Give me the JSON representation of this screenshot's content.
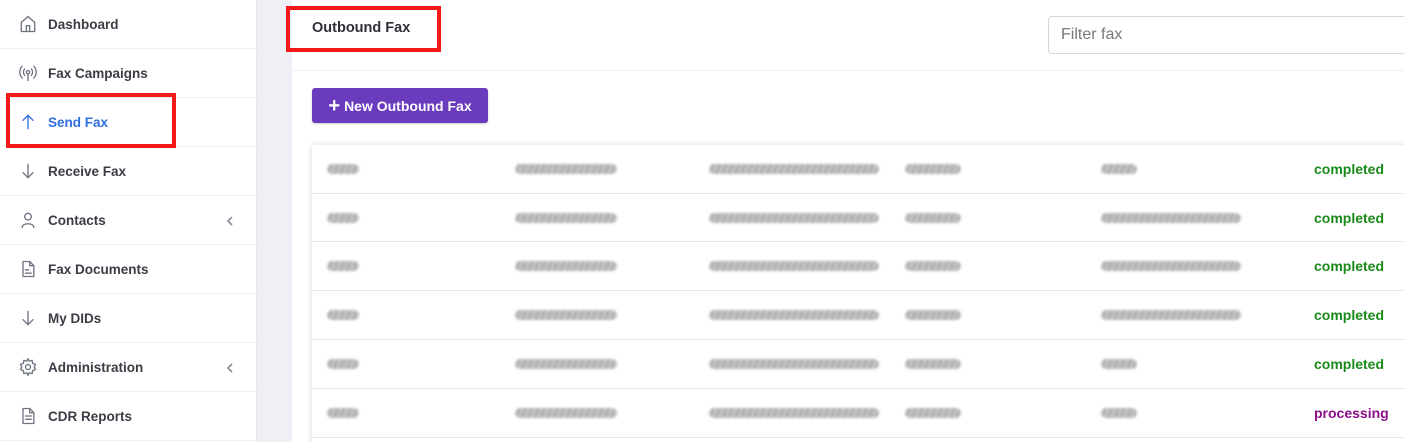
{
  "sidebar": {
    "items": [
      {
        "label": "Dashboard",
        "icon": "home-icon"
      },
      {
        "label": "Fax Campaigns",
        "icon": "broadcast-icon"
      },
      {
        "label": "Send Fax",
        "icon": "arrow-up-icon",
        "active": true
      },
      {
        "label": "Receive Fax",
        "icon": "arrow-down-icon"
      },
      {
        "label": "Contacts",
        "icon": "user-icon",
        "has_submenu": true
      },
      {
        "label": "Fax Documents",
        "icon": "document-icon"
      },
      {
        "label": "My DIDs",
        "icon": "arrow-down-icon"
      },
      {
        "label": "Administration",
        "icon": "gear-icon",
        "has_submenu": true
      },
      {
        "label": "CDR Reports",
        "icon": "report-icon"
      }
    ]
  },
  "header": {
    "title": "Outbound Fax",
    "filter_placeholder": "Filter fax"
  },
  "toolbar": {
    "new_button_label": "New Outbound Fax"
  },
  "table": {
    "rows": [
      {
        "status": "completed"
      },
      {
        "status": "completed"
      },
      {
        "status": "completed"
      },
      {
        "status": "completed"
      },
      {
        "status": "completed"
      },
      {
        "status": "processing"
      }
    ]
  },
  "colors": {
    "accent": "#2f6fe0",
    "button": "#6a3bbd",
    "highlight": "#f5191c",
    "status_completed": "#1a8a1a",
    "status_processing": "#8a0f8a"
  }
}
